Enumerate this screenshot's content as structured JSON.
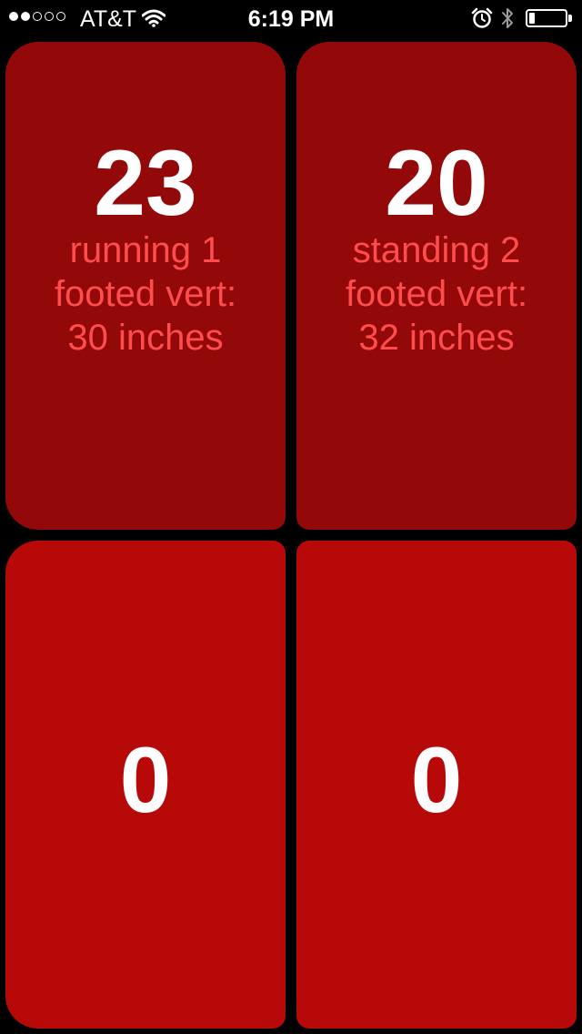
{
  "status_bar": {
    "carrier": "AT&T",
    "time": "6:19 PM",
    "signal_strength": 2,
    "signal_max": 5,
    "battery_level": 0.15
  },
  "colors": {
    "tile_top": "#930909",
    "tile_bottom": "#b80909",
    "label_text": "#ff4d4d",
    "count_text": "#ffffff",
    "background": "#000000"
  },
  "tiles": [
    {
      "count": "23",
      "label": "running 1\nfooted vert:\n30 inches"
    },
    {
      "count": "20",
      "label": "standing 2\nfooted vert:\n32 inches"
    },
    {
      "count": "0",
      "label": ""
    },
    {
      "count": "0",
      "label": ""
    }
  ]
}
